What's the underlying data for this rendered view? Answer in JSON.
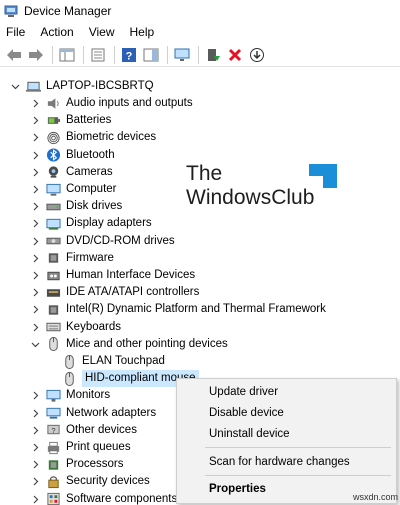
{
  "window": {
    "title": "Device Manager"
  },
  "menubar": {
    "items": [
      "File",
      "Action",
      "View",
      "Help"
    ]
  },
  "tree": {
    "root": "LAPTOP-IBCSBRTQ",
    "categories": [
      {
        "label": "Audio inputs and outputs",
        "icon": "speaker-icon",
        "expanded": false
      },
      {
        "label": "Batteries",
        "icon": "battery-icon",
        "expanded": false
      },
      {
        "label": "Biometric devices",
        "icon": "fingerprint-icon",
        "expanded": false
      },
      {
        "label": "Bluetooth",
        "icon": "bluetooth-icon",
        "expanded": false
      },
      {
        "label": "Cameras",
        "icon": "camera-icon",
        "expanded": false
      },
      {
        "label": "Computer",
        "icon": "computer-icon",
        "expanded": false
      },
      {
        "label": "Disk drives",
        "icon": "disk-drive-icon",
        "expanded": false
      },
      {
        "label": "Display adapters",
        "icon": "display-adapter-icon",
        "expanded": false
      },
      {
        "label": "DVD/CD-ROM drives",
        "icon": "dvd-drive-icon",
        "expanded": false
      },
      {
        "label": "Firmware",
        "icon": "chip-icon",
        "expanded": false
      },
      {
        "label": "Human Interface Devices",
        "icon": "hid-icon",
        "expanded": false
      },
      {
        "label": "IDE ATA/ATAPI controllers",
        "icon": "ide-controller-icon",
        "expanded": false
      },
      {
        "label": "Intel(R) Dynamic Platform and Thermal Framework",
        "icon": "chip-icon",
        "expanded": false
      },
      {
        "label": "Keyboards",
        "icon": "keyboard-icon",
        "expanded": false
      },
      {
        "label": "Mice and other pointing devices",
        "icon": "mouse-icon",
        "expanded": true
      },
      {
        "label": "Monitors",
        "icon": "monitor-icon",
        "expanded": false
      },
      {
        "label": "Network adapters",
        "icon": "network-adapter-icon",
        "expanded": false
      },
      {
        "label": "Other devices",
        "icon": "unknown-device-icon",
        "expanded": false
      },
      {
        "label": "Print queues",
        "icon": "printer-icon",
        "expanded": false
      },
      {
        "label": "Processors",
        "icon": "processor-icon",
        "expanded": false
      },
      {
        "label": "Security devices",
        "icon": "security-device-icon",
        "expanded": false
      },
      {
        "label": "Software components",
        "icon": "software-component-icon",
        "expanded": false
      }
    ],
    "children": [
      "ELAN Touchpad",
      "HID-compliant mouse"
    ],
    "selected": "HID-compliant mouse"
  },
  "context_menu": {
    "items": [
      "Update driver",
      "Disable device",
      "Uninstall device",
      "Scan for hardware changes",
      "Properties"
    ]
  },
  "watermark": {
    "line1": "The",
    "line2": "WindowsClub"
  },
  "source": "wsxdn.com",
  "colors": {
    "selection": "#cce8ff",
    "menu_bg": "#f2f2f2",
    "delete_red": "#e81123",
    "logo_blue": "#1a8fd8"
  }
}
